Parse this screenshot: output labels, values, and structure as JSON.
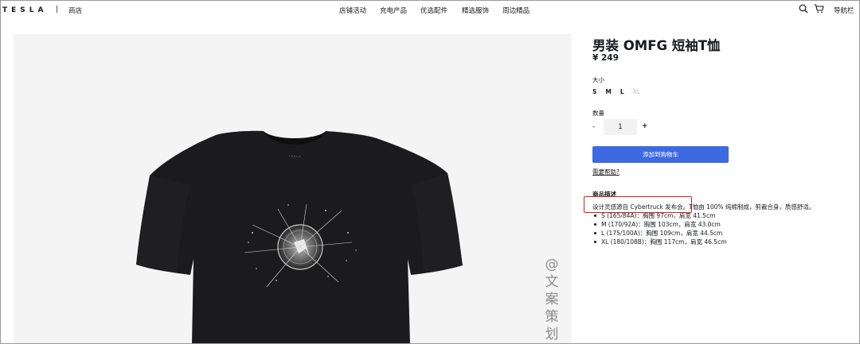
{
  "header": {
    "logo": "TESLA",
    "separator": "|",
    "shop": "商店",
    "nav": [
      "店铺活动",
      "充电产品",
      "优选配件",
      "精选服饰",
      "周边精品"
    ],
    "search_icon": "search-icon",
    "cart_icon": "cart-icon",
    "menu_label": "导航栏"
  },
  "product": {
    "title": "男装 OMFG 短袖T恤",
    "price": "¥ 249",
    "size_label": "大小",
    "sizes": [
      "S",
      "M",
      "L",
      "XL"
    ],
    "unavailable_size": "XL",
    "quantity_label": "数量",
    "quantity_minus": "-",
    "quantity_value": "1",
    "quantity_plus": "+",
    "add_to_cart": "添加到购物车",
    "help_link": "需要帮助?",
    "description_title": "商品描述",
    "description_text": "设计灵感源自 Cybertruck 发布会。T恤由 100% 纯棉制成，剪裁合身，质感舒适。",
    "size_specs": [
      "S (165/84A)：胸围 97cm，肩宽 41.5cm",
      "M (170/92A)：胸围 103cm，肩宽 43.0cm",
      "L (175/100A)：胸围 109cm，肩宽 44.5cm",
      "XL (180/108B)：胸围 117cm，肩宽 46.5cm"
    ],
    "image_print_text": "T E S L A"
  },
  "watermark": [
    "@",
    "文",
    "案",
    "策",
    "划"
  ],
  "colors": {
    "accent": "#3e6ae1",
    "highlight": "#e02020",
    "text": "#171a20",
    "image_bg": "#f4f4f4"
  }
}
